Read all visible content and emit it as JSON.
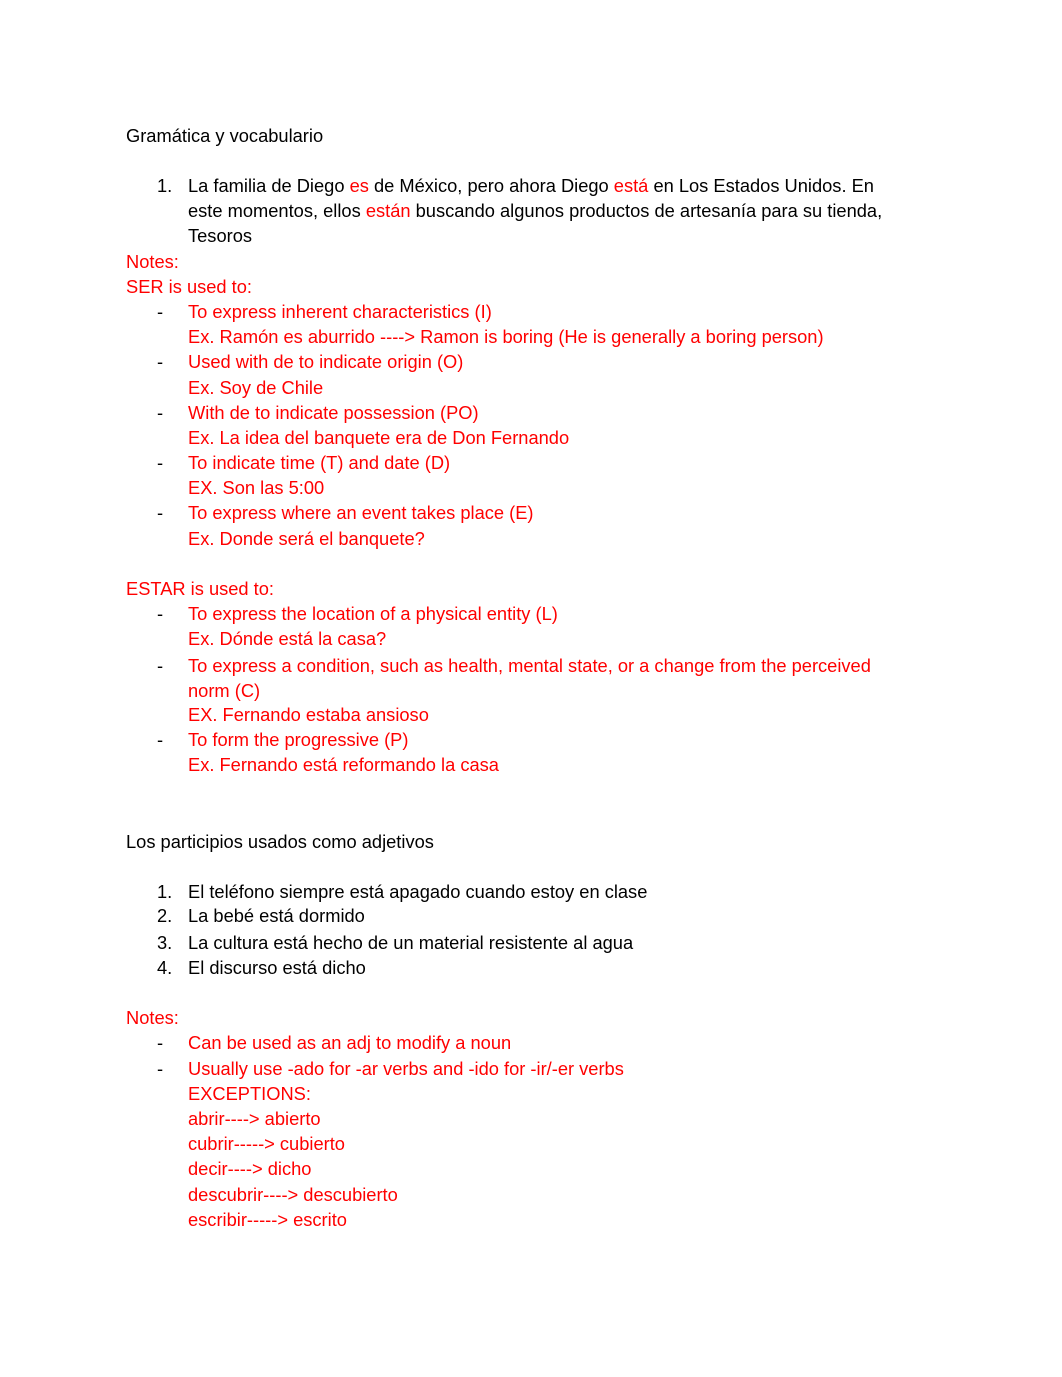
{
  "section1": {
    "title": "Gramática y vocabulario",
    "item1": {
      "number": "1.",
      "line1": {
        "a": "La familia de Diego ",
        "b": "es",
        "c": " de México, pero ahora Diego ",
        "d": "está",
        "e": " en Los Estados Unidos. En"
      },
      "line2": {
        "a": "este momentos, ellos ",
        "b": "están",
        "c": " buscando algunos productos de artesanía para su tienda,"
      },
      "line3": "Tesoros"
    },
    "notes_label": "Notes:",
    "ser_heading": "SER is used to:",
    "ser_items": [
      {
        "bullet": "-",
        "rule": "To express inherent characteristics (I)",
        "example": "Ex. Ramón es aburrido ----> Ramon is boring (He is generally a boring person)"
      },
      {
        "bullet": "-",
        "rule": "Used with de to indicate origin (O)",
        "example": "Ex. Soy de Chile"
      },
      {
        "bullet": "-",
        "rule": "With de to indicate possession (PO)",
        "example": "Ex. La idea del banquete era de Don Fernando"
      },
      {
        "bullet": "-",
        "rule": "To indicate time (T) and date (D)",
        "example": "EX. Son las 5:00"
      },
      {
        "bullet": "-",
        "rule": "To express where an event takes place (E)",
        "example": "Ex. Donde será el banquete?"
      }
    ],
    "estar_heading": "ESTAR is used to:",
    "estar_items": [
      {
        "bullet": "-",
        "rule": "To express the location of a physical entity (L)",
        "example": "Ex. Dónde está la casa?"
      },
      {
        "bullet": "-",
        "rule": "To express a condition, such as health, mental state, or a change from the perceived",
        "rule_cont": "norm (C)",
        "example": "EX. Fernando estaba ansioso"
      },
      {
        "bullet": "-",
        "rule": "To form the progressive (P)",
        "example": "Ex. Fernando está reformando la casa"
      }
    ]
  },
  "section2": {
    "title": "Los participios usados como adjetivos",
    "items": [
      {
        "number": "1.",
        "text": "El teléfono siempre está apagado cuando estoy en clase"
      },
      {
        "number": "2.",
        "text": "La bebé está dormido"
      },
      {
        "number": "3.",
        "text": "La cultura está hecho de un material resistente al agua"
      },
      {
        "number": "4.",
        "text": "El discurso está dicho"
      }
    ],
    "notes_label": "Notes:",
    "notes": [
      {
        "bullet": "-",
        "text": "Can be used as an adj to modify a noun"
      },
      {
        "bullet": "-",
        "text": "Usually use -ado for -ar verbs and -ido for -ir/-er verbs"
      }
    ],
    "exceptions_label": "EXCEPTIONS:",
    "exceptions": [
      "abrir----> abierto",
      "cubrir-----> cubierto",
      "decir----> dicho",
      "descubrir----> descubierto",
      "escribir-----> escrito"
    ]
  },
  "colors": {
    "text": "#000000",
    "accent": "#ff0000"
  }
}
